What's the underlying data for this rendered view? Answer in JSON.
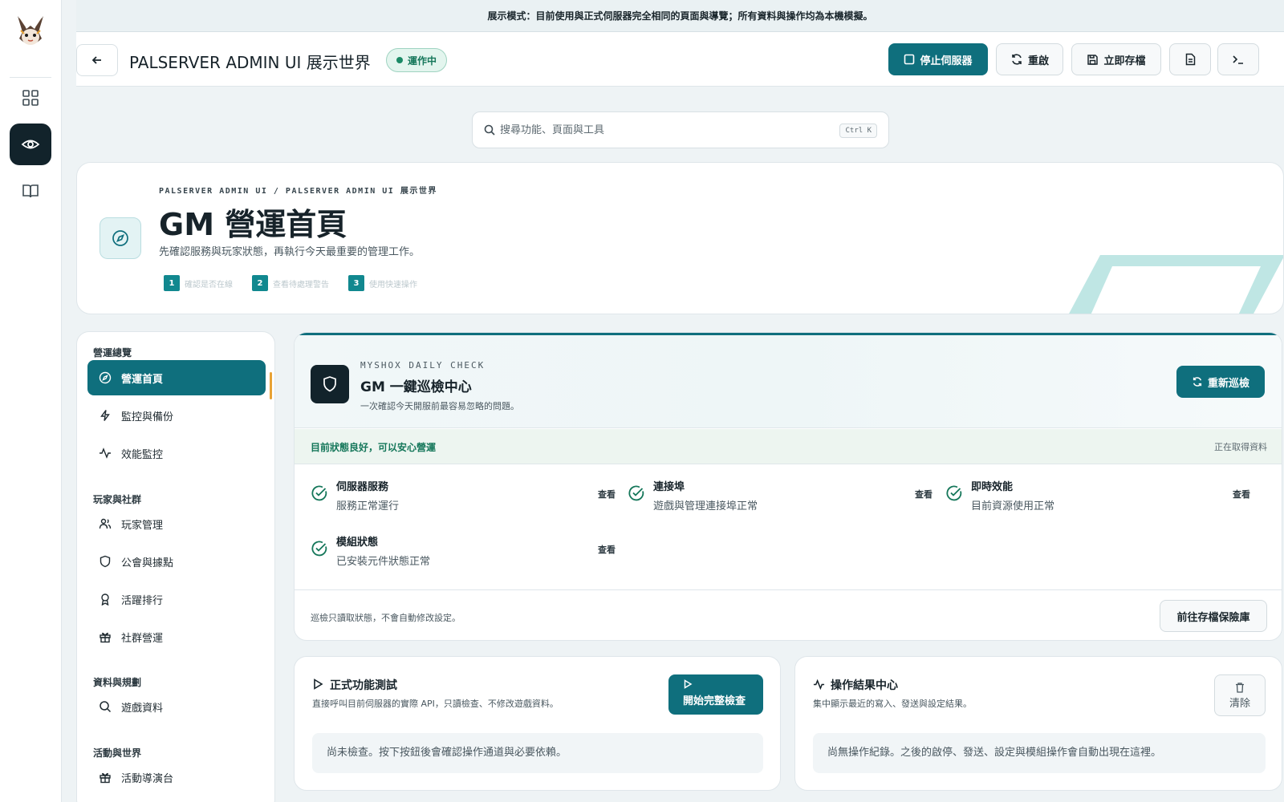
{
  "notice": "展示模式：目前使用與正式伺服器完全相同的頁面與導覽；所有資料與操作均為本機模擬。",
  "rail": {
    "icons": [
      "logo",
      "grid-icon",
      "eye-icon",
      "book-icon"
    ]
  },
  "topbar": {
    "server_title": "PALSERVER ADMIN UI 展示世界",
    "status": "運作中",
    "stop_label": "停止伺服器",
    "restart_label": "重啟",
    "save_label": "立即存檔"
  },
  "search": {
    "placeholder": "搜尋功能、頁面與工具",
    "shortcut": "Ctrl K"
  },
  "hero": {
    "breadcrumb": "PALSERVER ADMIN UI / PALSERVER ADMIN UI 展示世界",
    "title": "GM 營運首頁",
    "subtitle": "先確認服務與玩家狀態，再執行今天最重要的管理工作。",
    "steps": [
      {
        "num": "1",
        "label": "確認是否在線"
      },
      {
        "num": "2",
        "label": "查看待處理警告"
      },
      {
        "num": "3",
        "label": "使用快速操作"
      }
    ]
  },
  "sidebar": {
    "groups": [
      "營運總覽",
      "玩家與社群",
      "資料與規劃",
      "活動與世界"
    ],
    "items": [
      {
        "label": "營運首頁",
        "icon": "compass-icon"
      },
      {
        "label": "監控與備份",
        "icon": "bolt-icon"
      },
      {
        "label": "效能監控",
        "icon": "pulse-icon"
      },
      {
        "label": "玩家管理",
        "icon": "users-icon"
      },
      {
        "label": "公會與據點",
        "icon": "shield-icon"
      },
      {
        "label": "活躍排行",
        "icon": "award-icon"
      },
      {
        "label": "社群營運",
        "icon": "gift-icon"
      },
      {
        "label": "遊戲資料",
        "icon": "search-icon"
      },
      {
        "label": "活動導演台",
        "icon": "gift-icon"
      }
    ]
  },
  "check": {
    "eyebrow": "MYSHOX DAILY CHECK",
    "title": "GM 一鍵巡檢中心",
    "subtitle": "一次確認今天開服前最容易忽略的問題。",
    "recheck": "重新巡檢",
    "status_ok": "目前狀態良好，可以安心營運",
    "fetching": "正在取得資料",
    "items": [
      {
        "name": "伺服器服務",
        "desc": "服務正常運行",
        "view": "查看"
      },
      {
        "name": "連接埠",
        "desc": "遊戲與管理連接埠正常",
        "view": "查看"
      },
      {
        "name": "即時效能",
        "desc": "目前資源使用正常",
        "view": "查看"
      },
      {
        "name": "模組狀態",
        "desc": "已安裝元件狀態正常",
        "view": "查看"
      }
    ],
    "note": "巡檢只讀取狀態，不會自動修改設定。",
    "vault": "前往存檔保險庫"
  },
  "test_card": {
    "title": "正式功能測試",
    "subtitle": "直接呼叫目前伺服器的實際 API，只讀檢查、不修改遊戲資料。",
    "button": "開始完整檢查",
    "empty": "尚未檢查。按下按鈕後會確認操作通道與必要依賴。"
  },
  "result_card": {
    "title": "操作結果中心",
    "subtitle": "集中顯示最近的寫入、發送與設定結果。",
    "clear": "清除",
    "empty": "尚無操作紀錄。之後的啟停、發送、設定與模組操作會自動出現在這裡。"
  },
  "colors": {
    "accent": "#0f6f7d",
    "dark": "#12232b",
    "ok": "#15775a",
    "active_marker": "#e8a235"
  }
}
